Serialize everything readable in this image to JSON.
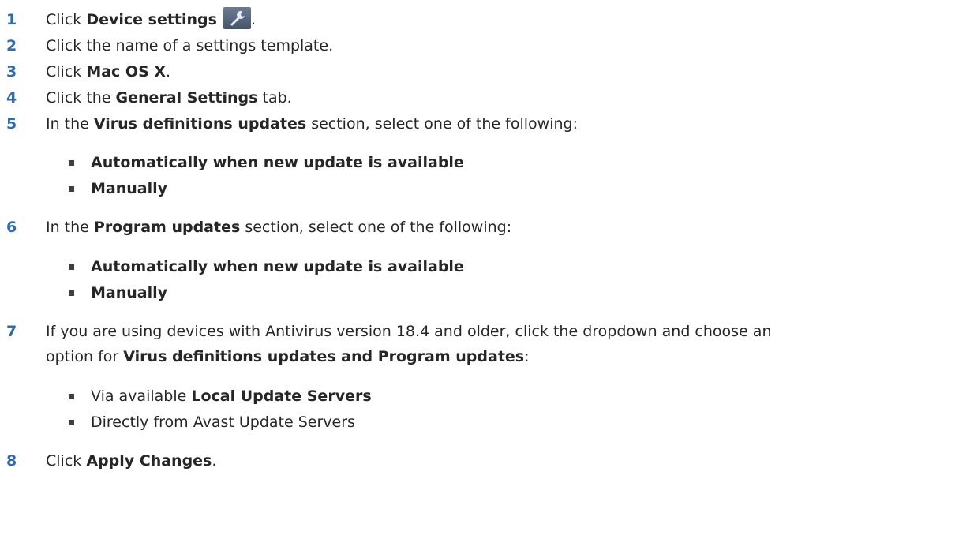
{
  "steps": [
    {
      "num": "1",
      "pre": "Click ",
      "bold": "Device settings",
      "post": ".",
      "icon": "wrench-icon"
    },
    {
      "num": "2",
      "text": "Click the name of a settings template."
    },
    {
      "num": "3",
      "pre": "Click ",
      "bold": "Mac OS X",
      "post": "."
    },
    {
      "num": "4",
      "pre": "Click the ",
      "bold": "General Settings",
      "post": " tab."
    },
    {
      "num": "5",
      "pre": "In the ",
      "bold": "Virus definitions updates",
      "post": " section, select one of the following:",
      "options": [
        "Automatically when new update is available",
        "Manually"
      ]
    },
    {
      "num": "6",
      "pre": "In the ",
      "bold": "Program updates",
      "post": " section, select one of the following:",
      "options": [
        "Automatically when new update is available",
        "Manually"
      ]
    },
    {
      "num": "7",
      "line1": "If you are using devices with Antivirus version 18.4 and older, click the dropdown and choose an",
      "line2_pre": "option for ",
      "line2_bold": "Virus definitions updates and Program updates",
      "line2_post": ":",
      "options": [
        {
          "pre": "Via available ",
          "bold": "Local Update Servers"
        },
        {
          "text": "Directly from Avast Update Servers"
        }
      ]
    },
    {
      "num": "8",
      "pre": "Click ",
      "bold": "Apply Changes",
      "post": "."
    }
  ]
}
